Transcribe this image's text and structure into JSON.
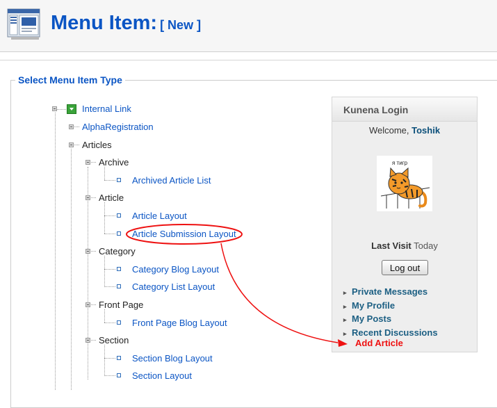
{
  "header": {
    "title": "Menu Item:",
    "badge": "[ New ]"
  },
  "section": {
    "legend": "Select Menu Item Type"
  },
  "tree": {
    "internal_link": "Internal Link",
    "alpha_registration": "AlphaRegistration",
    "articles": "Articles",
    "archive": "Archive",
    "archived_article_list": "Archived Article List",
    "article": "Article",
    "article_layout": "Article Layout",
    "article_submission_layout": "Article Submission Layout",
    "category": "Category",
    "category_blog_layout": "Category Blog Layout",
    "category_list_layout": "Category List Layout",
    "front_page": "Front Page",
    "front_page_blog_layout": "Front Page Blog Layout",
    "section": "Section",
    "section_blog_layout": "Section Blog Layout",
    "section_layout": "Section Layout"
  },
  "annotation": {
    "label": "Add Article",
    "color": "#ee1111"
  },
  "login": {
    "title": "Kunena Login",
    "welcome_prefix": "Welcome,",
    "username": "Toshik",
    "avatar_caption": "я тигр",
    "last_visit_label": "Last Visit",
    "last_visit_value": "Today",
    "logout_label": "Log out",
    "links": [
      "Private Messages",
      "My Profile",
      "My Posts",
      "Recent Discussions"
    ]
  },
  "colors": {
    "link": "#0b55c4",
    "panel_link": "#1c5f83",
    "accent_green": "#3aa33a"
  }
}
